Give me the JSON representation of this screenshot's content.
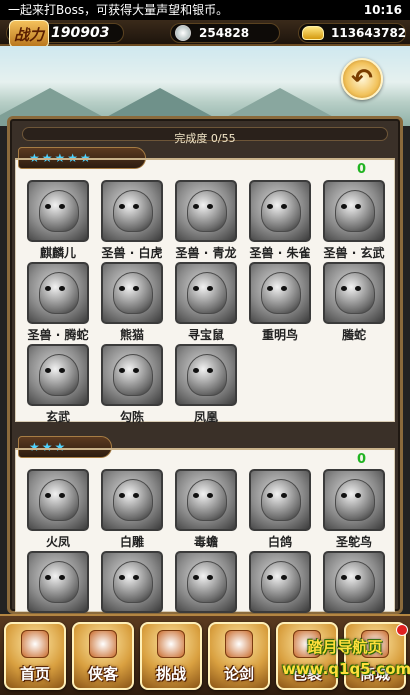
{
  "status": {
    "marquee": "一起来打Boss，可获得大量声望和银币。",
    "time": "10:16"
  },
  "resources": {
    "power_label": "战力",
    "power_value": "190903",
    "silver": "254828",
    "gold": "113643782"
  },
  "icons": {
    "back": "back-arrow-icon",
    "silver": "silver-coin-icon",
    "gold": "gold-ingot-icon"
  },
  "collection": {
    "progress_label": "完成度 0/55",
    "progress": 0
  },
  "sections": [
    {
      "stars": "★★★★★",
      "count": "0",
      "items": [
        "麒麟儿",
        "圣兽 · 白虎",
        "圣兽 · 青龙",
        "圣兽 · 朱雀",
        "圣兽 · 玄武",
        "圣兽 · 腾蛇",
        "熊猫",
        "寻宝鼠",
        "重明鸟",
        "螣蛇",
        "玄武",
        "勾陈",
        "凤凰"
      ]
    },
    {
      "stars": "★★★",
      "count": "0",
      "items": [
        "火凤",
        "白雕",
        "毒蟾",
        "白鸽",
        "圣鸵鸟",
        "",
        "",
        "",
        "",
        ""
      ]
    }
  ],
  "nav": {
    "items": [
      "首页",
      "侠客",
      "挑战",
      "论剑",
      "包裹",
      "商城"
    ]
  },
  "watermark": {
    "line1": "踏月导航页",
    "line2": "www.q1q5.com"
  },
  "colors": {
    "accent_gold": "#d9a040",
    "count_green": "#22b322",
    "star_blue": "#4fd3ff"
  }
}
